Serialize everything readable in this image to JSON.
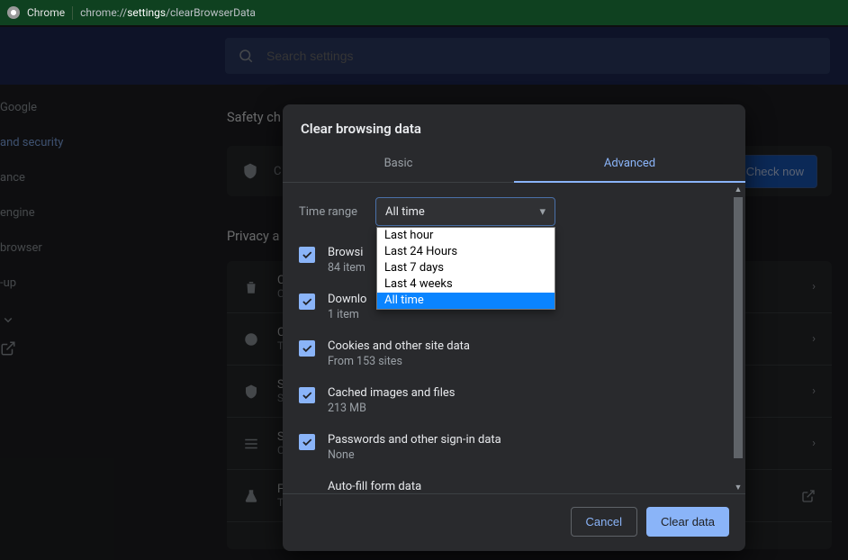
{
  "titlebar": {
    "browser": "Chrome",
    "url_prefix": "chrome://",
    "url_strong": "settings",
    "url_suffix": "/clearBrowserData"
  },
  "search": {
    "placeholder": "Search settings"
  },
  "sidebar": {
    "items": [
      {
        "label": "Google"
      },
      {
        "label": "and security"
      },
      {
        "label": "ance"
      },
      {
        "label": "engine"
      },
      {
        "label": "browser"
      },
      {
        "label": "-up"
      }
    ]
  },
  "safety": {
    "heading": "Safety ch",
    "row_label": "C",
    "check_now": "Check now"
  },
  "privacy": {
    "heading": "Privacy a",
    "rows": [
      {
        "icon": "trash",
        "t1": "C",
        "t2": "C"
      },
      {
        "icon": "cookie",
        "t1": "C",
        "t2": "T"
      },
      {
        "icon": "shield",
        "t1": "S",
        "t2": "S"
      },
      {
        "icon": "tune",
        "t1": "S",
        "t2": "C"
      },
      {
        "icon": "flask",
        "t1": "F",
        "t2": "T"
      }
    ]
  },
  "modal": {
    "title": "Clear browsing data",
    "tabs": {
      "basic": "Basic",
      "advanced": "Advanced"
    },
    "time_label": "Time range",
    "time_selected": "All time",
    "time_options": [
      "Last hour",
      "Last 24 Hours",
      "Last 7 days",
      "Last 4 weeks",
      "All time"
    ],
    "checks": [
      {
        "label": "Browsi",
        "sub": "84 item"
      },
      {
        "label": "Downlo",
        "sub": "1 item"
      },
      {
        "label": "Cookies and other site data",
        "sub": "From 153 sites"
      },
      {
        "label": "Cached images and files",
        "sub": "213 MB"
      },
      {
        "label": "Passwords and other sign-in data",
        "sub": "None"
      },
      {
        "label": "Auto-fill form data",
        "sub": ""
      }
    ],
    "cancel": "Cancel",
    "clear": "Clear data"
  }
}
